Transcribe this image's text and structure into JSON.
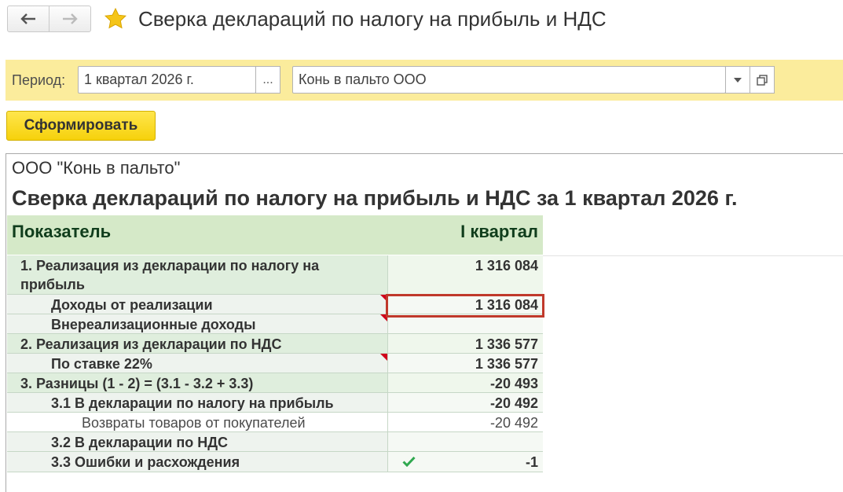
{
  "header": {
    "title": "Сверка деклараций по налогу на прибыль и НДС"
  },
  "filters": {
    "period_label": "Период:",
    "period_value": "1 квартал 2026 г.",
    "select_button": "...",
    "organization": "Конь в пальто ООО"
  },
  "toolbar": {
    "generate_label": "Сформировать"
  },
  "report": {
    "organization": "ООО \"Конь в пальто\"",
    "title": "Сверка деклараций по налогу на прибыль и НДС за 1 квартал 2026 г.",
    "columns": [
      "Показатель",
      "I квартал"
    ],
    "rows": [
      {
        "label": "1. Реализация из декларации по налогу на прибыль",
        "value": "1 316 084"
      },
      {
        "label": "Доходы от реализации",
        "value": "1 316 084"
      },
      {
        "label": "Внереализационные доходы",
        "value": ""
      },
      {
        "label": "2. Реализация из декларации по НДС",
        "value": "1 336 577"
      },
      {
        "label": "По ставке 22%",
        "value": "1 336 577"
      },
      {
        "label": "3. Разницы (1 - 2) = (3.1 - 3.2 + 3.3)",
        "value": "-20 493"
      },
      {
        "label": "3.1 В декларации по налогу на прибыль",
        "value": "-20 492"
      },
      {
        "label": "Возвраты товаров от покупателей",
        "value": "-20 492"
      },
      {
        "label": "3.2 В декларации по НДС",
        "value": ""
      },
      {
        "label": "3.3 Ошибки и расхождения",
        "value": "-1"
      }
    ]
  },
  "colors": {
    "filter_bar": "#fbec9c",
    "header_row": "#d5e9c8",
    "accent_button": "#f6d10b",
    "highlight_border": "#c0392b",
    "note_marker": "#d0001b"
  },
  "icons": [
    "back-arrow-icon",
    "forward-arrow-icon",
    "favorite-star-icon",
    "dropdown-arrow-icon",
    "open-in-window-icon",
    "check-icon"
  ]
}
